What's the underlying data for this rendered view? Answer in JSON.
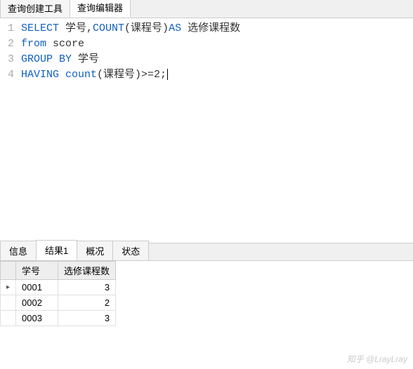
{
  "top_tabs": {
    "builder": "查询创建工具",
    "editor": "查询编辑器"
  },
  "sql": {
    "lines": [
      {
        "num": "1",
        "tokens": [
          "SELECT",
          " 学号,",
          "COUNT",
          "(课程号)",
          "AS",
          " 选修课程数"
        ]
      },
      {
        "num": "2",
        "tokens": [
          "from",
          " score"
        ]
      },
      {
        "num": "3",
        "tokens": [
          "GROUP BY",
          " 学号"
        ]
      },
      {
        "num": "4",
        "tokens": [
          "HAVING",
          " ",
          "count",
          "(课程号)>=2;"
        ]
      }
    ]
  },
  "bottom_tabs": {
    "info": "信息",
    "result": "结果1",
    "profile": "概况",
    "status": "状态"
  },
  "result": {
    "columns": [
      "学号",
      "选修课程数"
    ],
    "rows": [
      {
        "c0": "0001",
        "c1": "3"
      },
      {
        "c0": "0002",
        "c1": "2"
      },
      {
        "c0": "0003",
        "c1": "3"
      }
    ]
  },
  "watermark": "知乎 @LrayLray"
}
